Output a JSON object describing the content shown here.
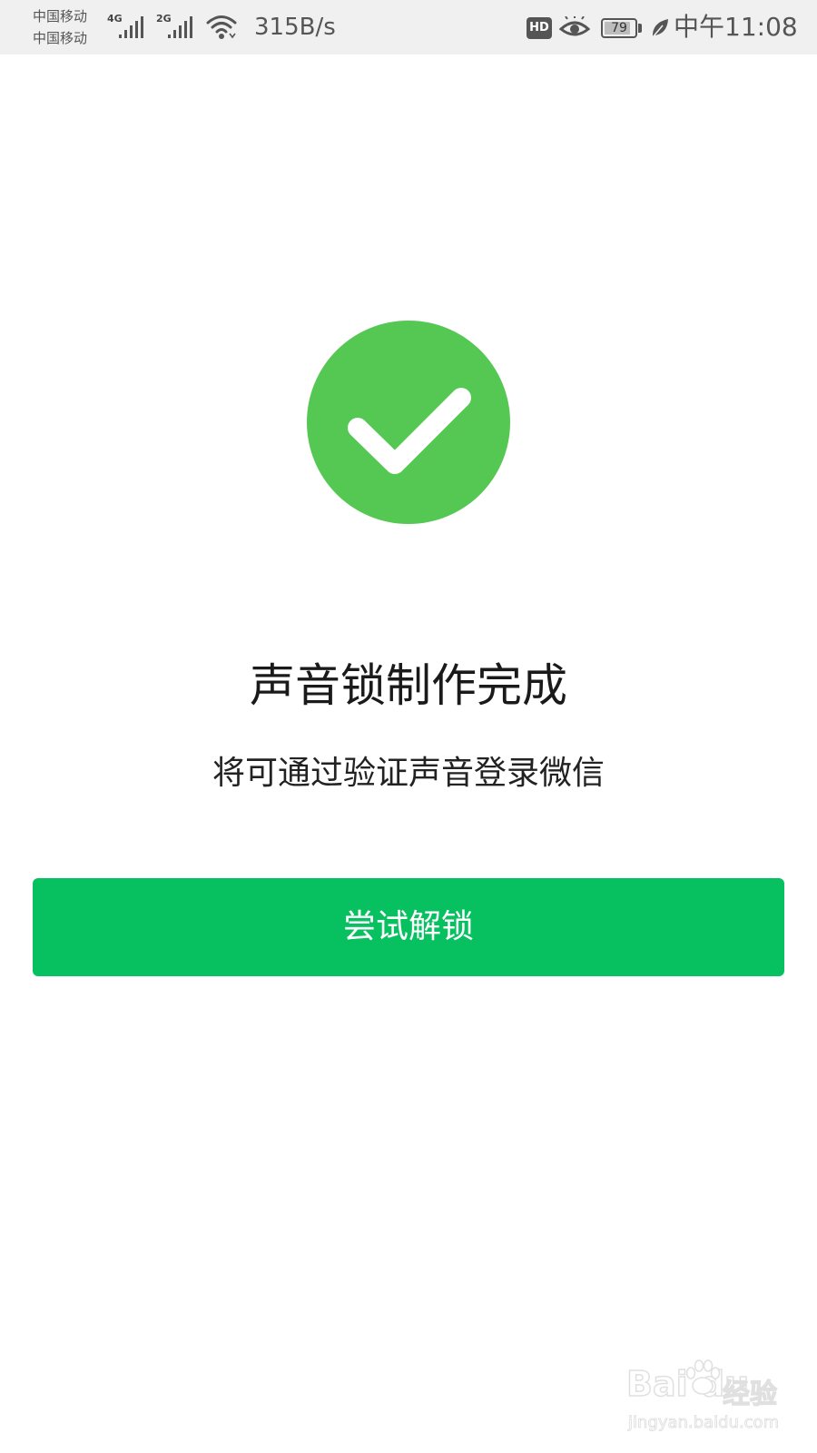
{
  "status_bar": {
    "carrier_1": "中国移动",
    "carrier_2": "中国移动",
    "sim1_network": "4G",
    "sim2_network": "2G",
    "net_speed": "315B/s",
    "hd_badge": "HD",
    "battery_level": "79",
    "time": "中午11:08",
    "icons": [
      "signal-icon",
      "wifi-icon",
      "eye-icon",
      "battery-icon",
      "leaf-icon"
    ]
  },
  "main": {
    "status_icon": "check-circle-icon",
    "title": "声音锁制作完成",
    "subtitle": "将可通过验证声音登录微信",
    "primary_button_label": "尝试解锁"
  },
  "watermark": {
    "brand": "Bai du",
    "product": "经验",
    "site": "jingyan.baidu.com"
  },
  "colors": {
    "accent_green": "#07c160",
    "success_icon_green": "#55c853",
    "status_bar_bg": "#f0f0f0",
    "text_primary": "#1a1a1a"
  }
}
